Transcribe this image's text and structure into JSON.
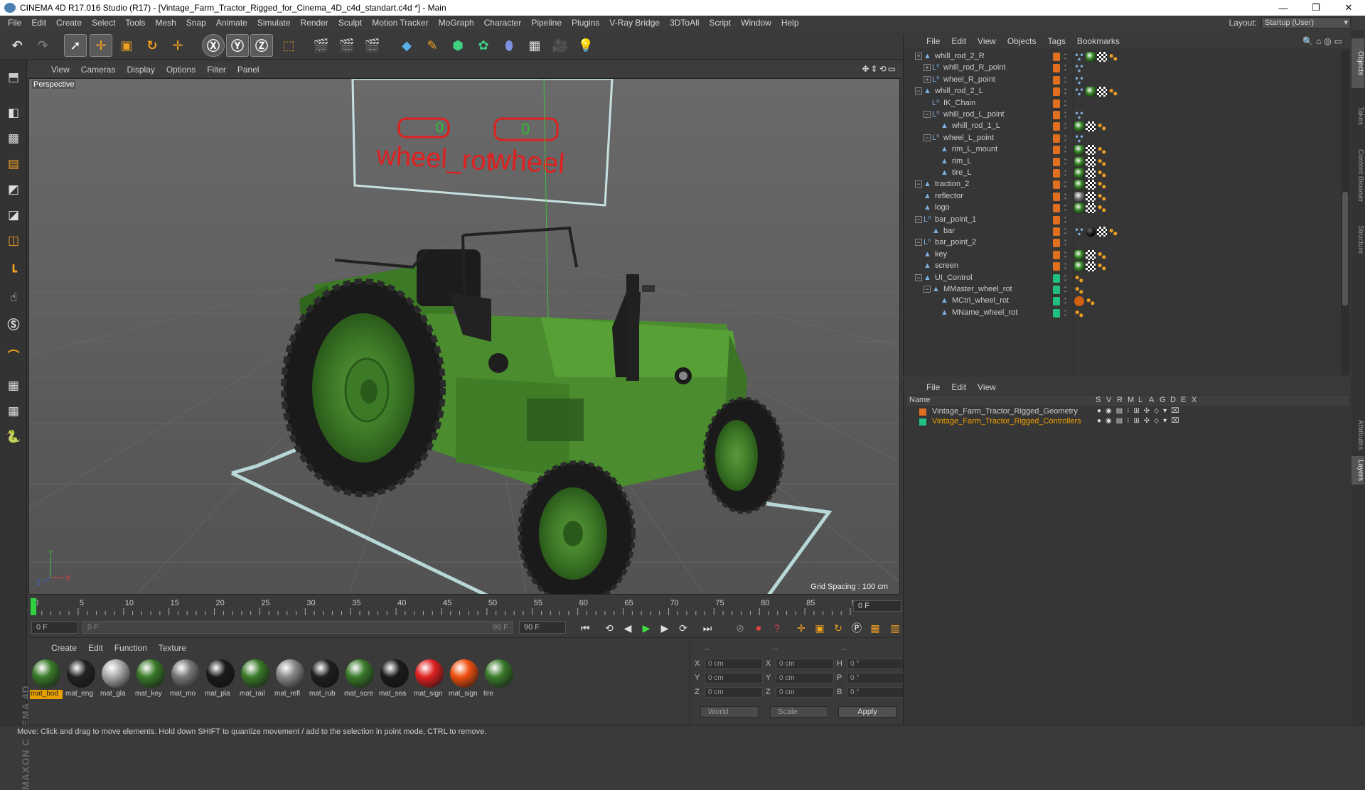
{
  "window": {
    "title": "CINEMA 4D R17.016 Studio (R17) - [Vintage_Farm_Tractor_Rigged_for_Cinema_4D_c4d_standart.c4d *] - Main"
  },
  "menu": [
    "File",
    "Edit",
    "Create",
    "Select",
    "Tools",
    "Mesh",
    "Snap",
    "Animate",
    "Simulate",
    "Render",
    "Sculpt",
    "Motion Tracker",
    "MoGraph",
    "Character",
    "Pipeline",
    "Plugins",
    "V-Ray Bridge",
    "3DToAll",
    "Script",
    "Window",
    "Help"
  ],
  "layout": {
    "label": "Layout:",
    "value": "Startup (User)"
  },
  "viewport": {
    "menu": [
      "View",
      "Cameras",
      "Display",
      "Options",
      "Filter",
      "Panel"
    ],
    "label": "Perspective",
    "grid_spacing": "Grid Spacing : 100 cm",
    "overlay_text_1": "wheel_rot",
    "overlay_text_2": "wheel",
    "slider_value_1": "0",
    "slider_value_2": "0",
    "axis_y": "Y",
    "axis_x": "X",
    "axis_z": "Z"
  },
  "timeline": {
    "ticks": [
      "0",
      "5",
      "10",
      "15",
      "20",
      "25",
      "30",
      "35",
      "40",
      "45",
      "50",
      "55",
      "60",
      "65",
      "70",
      "75",
      "80",
      "85",
      "90"
    ],
    "frame": "0 F",
    "start": "0 F",
    "range_start": "0 F",
    "range_end": "90 F",
    "end": "90 F"
  },
  "materials": {
    "menu": [
      "Create",
      "Edit",
      "Function",
      "Texture"
    ],
    "items": [
      {
        "name": "mat_bod",
        "color": "#3a7a2a"
      },
      {
        "name": "mat_eng",
        "color": "#222222"
      },
      {
        "name": "mat_gla",
        "color": "#aaaaaa"
      },
      {
        "name": "mat_key",
        "color": "#3a7a2a"
      },
      {
        "name": "mat_mo",
        "color": "#777777"
      },
      {
        "name": "mat_pla",
        "color": "#1a1a1a"
      },
      {
        "name": "mat_rail",
        "color": "#3a7a2a"
      },
      {
        "name": "mat_refl",
        "color": "#888888"
      },
      {
        "name": "mat_rub",
        "color": "#1e1e1e"
      },
      {
        "name": "mat_scre",
        "color": "#3a7a2a"
      },
      {
        "name": "mat_sea",
        "color": "#1a1a1a"
      },
      {
        "name": "mat_sign",
        "color": "#e02020"
      },
      {
        "name": "mat_sign",
        "color": "#f05010"
      },
      {
        "name": "tire",
        "color": "#3a7a2a"
      }
    ]
  },
  "coords": {
    "header": [
      "--",
      "--",
      "--"
    ],
    "rows": [
      {
        "a": "X",
        "av": "0 cm",
        "b": "X",
        "bv": "0 cm",
        "c": "H",
        "cv": "0 °"
      },
      {
        "a": "Y",
        "av": "0 cm",
        "b": "Y",
        "bv": "0 cm",
        "c": "P",
        "cv": "0 °"
      },
      {
        "a": "Z",
        "av": "0 cm",
        "b": "Z",
        "bv": "0 cm",
        "c": "B",
        "cv": "0 °"
      }
    ],
    "world": "World",
    "scale": "Scale",
    "apply": "Apply"
  },
  "objects": {
    "menu": [
      "File",
      "Edit",
      "View",
      "Objects",
      "Tags",
      "Bookmarks"
    ],
    "rows": [
      {
        "name": "whill_rod_2_R",
        "indent": 2,
        "icon": "joint",
        "layer": "#e07020",
        "tags": [
          "dots",
          "green",
          "check",
          "orange"
        ]
      },
      {
        "name": "whill_rod_R_point",
        "indent": 3,
        "icon": "null",
        "layer": "#e07020",
        "tags": [
          "dots"
        ]
      },
      {
        "name": "wheel_R_point",
        "indent": 3,
        "icon": "null",
        "layer": "#e07020",
        "tags": [
          "dots"
        ]
      },
      {
        "name": "whill_rod_2_L",
        "indent": 2,
        "icon": "joint",
        "layer": "#e07020",
        "tags": [
          "dots",
          "green",
          "check",
          "orange"
        ]
      },
      {
        "name": "IK_Chain",
        "indent": 3,
        "icon": "null",
        "layer": "#e07020",
        "tags": []
      },
      {
        "name": "whill_rod_L_point",
        "indent": 3,
        "icon": "null",
        "layer": "#e07020",
        "tags": [
          "dots"
        ]
      },
      {
        "name": "whill_rod_1_L",
        "indent": 4,
        "icon": "joint",
        "layer": "#e07020",
        "tags": [
          "green",
          "check",
          "orange"
        ]
      },
      {
        "name": "wheel_L_point",
        "indent": 3,
        "icon": "null",
        "layer": "#e07020",
        "tags": [
          "dots"
        ]
      },
      {
        "name": "rim_L_mount",
        "indent": 4,
        "icon": "joint",
        "layer": "#e07020",
        "tags": [
          "green",
          "check",
          "orange"
        ]
      },
      {
        "name": "rim_L",
        "indent": 4,
        "icon": "joint",
        "layer": "#e07020",
        "tags": [
          "green",
          "check",
          "orange"
        ]
      },
      {
        "name": "tire_L",
        "indent": 4,
        "icon": "joint",
        "layer": "#e07020",
        "tags": [
          "green",
          "check",
          "orange"
        ]
      },
      {
        "name": "traction_2",
        "indent": 2,
        "icon": "joint",
        "layer": "#e07020",
        "tags": [
          "green",
          "check",
          "orange"
        ]
      },
      {
        "name": "reflector",
        "indent": 2,
        "icon": "joint",
        "layer": "#e07020",
        "tags": [
          "grey",
          "check",
          "orange"
        ]
      },
      {
        "name": "logo",
        "indent": 2,
        "icon": "joint",
        "layer": "#e07020",
        "tags": [
          "green",
          "check",
          "orange"
        ]
      },
      {
        "name": "bar_point_1",
        "indent": 2,
        "icon": "null",
        "layer": "#e07020",
        "tags": []
      },
      {
        "name": "bar",
        "indent": 3,
        "icon": "joint",
        "layer": "#e07020",
        "tags": [
          "dots",
          "black",
          "check",
          "orange"
        ]
      },
      {
        "name": "bar_point_2",
        "indent": 2,
        "icon": "null",
        "layer": "#e07020",
        "tags": []
      },
      {
        "name": "key",
        "indent": 2,
        "icon": "joint",
        "layer": "#e07020",
        "tags": [
          "green",
          "check",
          "orange"
        ]
      },
      {
        "name": "screen",
        "indent": 2,
        "icon": "joint",
        "layer": "#e07020",
        "tags": [
          "green",
          "check",
          "orange"
        ]
      },
      {
        "name": "UI_Control",
        "indent": 2,
        "icon": "joint",
        "layer": "#20c080",
        "tags": [
          "orange"
        ]
      },
      {
        "name": "MMaster_wheel_rot",
        "indent": 3,
        "icon": "joint",
        "layer": "#20c080",
        "tags": [
          "orange"
        ]
      },
      {
        "name": "MCtrl_wheel_rot",
        "indent": 4,
        "icon": "joint",
        "layer": "#20c080",
        "tags": [
          "forbid",
          "orange"
        ]
      },
      {
        "name": "MName_wheel_rot",
        "indent": 4,
        "icon": "joint",
        "layer": "#20c080",
        "tags": [
          "orange"
        ]
      }
    ]
  },
  "layers": {
    "menu": [
      "File",
      "Edit",
      "View"
    ],
    "header": {
      "name": "Name",
      "cols": [
        "S",
        "V",
        "R",
        "M",
        "L",
        "A",
        "G",
        "D",
        "E",
        "X"
      ]
    },
    "rows": [
      {
        "name": "Vintage_Farm_Tractor_Rigged_Geometry",
        "color": "#e07020",
        "text": "#cccccc"
      },
      {
        "name": "Vintage_Farm_Tractor_Rigged_Controllers",
        "color": "#20c080",
        "text": "#f0a000"
      }
    ]
  },
  "sidetabs": [
    "Objects",
    "Takes",
    "Content Browser",
    "Structure",
    "Attributes",
    "Layers"
  ],
  "status": "Move: Click and drag to move elements. Hold down SHIFT to quantize movement / add to the selection in point mode, CTRL to remove.",
  "brand": "MAXON CINEMA 4D"
}
